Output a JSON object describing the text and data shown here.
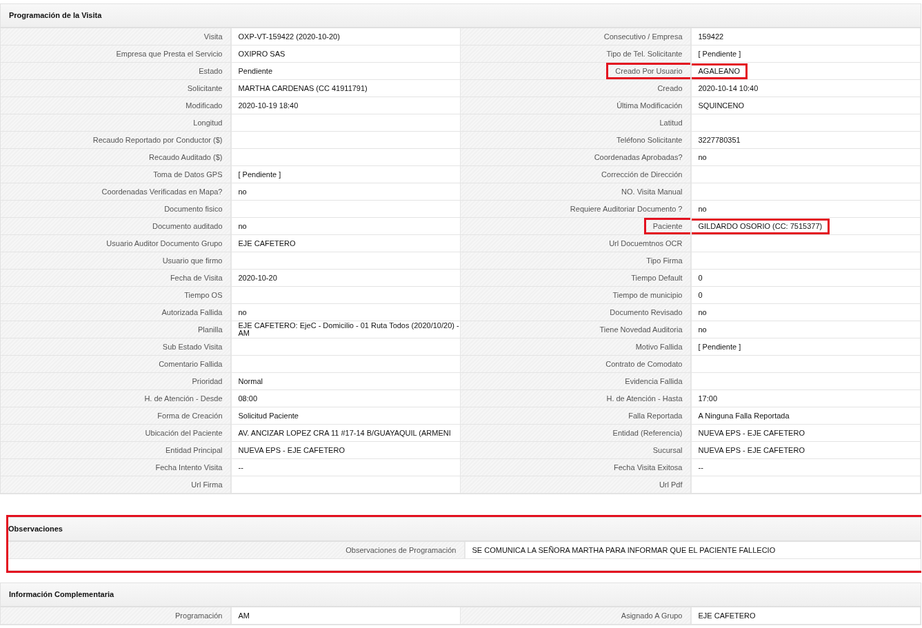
{
  "sections": [
    {
      "title": "Programación de la Visita",
      "highlighted": false,
      "rows": [
        [
          {
            "label": "Visita",
            "value": "OXP-VT-159422 (2020-10-20)",
            "highlighted": false
          },
          {
            "label": "Consecutivo / Empresa",
            "value": "159422",
            "highlighted": false
          }
        ],
        [
          {
            "label": "Empresa que Presta el Servicio",
            "value": "OXIPRO SAS",
            "highlighted": false
          },
          {
            "label": "Tipo de Tel. Solicitante",
            "value": "[ Pendiente ]",
            "highlighted": false
          }
        ],
        [
          {
            "label": "Estado",
            "value": "Pendiente",
            "highlighted": false
          },
          {
            "label": "Creado Por Usuario",
            "value": "AGALEANO",
            "highlighted": true
          }
        ],
        [
          {
            "label": "Solicitante",
            "value": "MARTHA CARDENAS (CC 41911791)",
            "highlighted": false
          },
          {
            "label": "Creado",
            "value": "2020-10-14 10:40",
            "highlighted": false
          }
        ],
        [
          {
            "label": "Modificado",
            "value": "2020-10-19 18:40",
            "highlighted": false
          },
          {
            "label": "Última Modificación",
            "value": "SQUINCENO",
            "highlighted": false
          }
        ],
        [
          {
            "label": "Longitud",
            "highlighted": false
          },
          {
            "label": "Latitud",
            "highlighted": false
          }
        ],
        [
          {
            "label": "Recaudo Reportado por Conductor ($)",
            "highlighted": false
          },
          {
            "label": "Teléfono Solicitante",
            "value": "3227780351",
            "highlighted": false
          }
        ],
        [
          {
            "label": "Recaudo Auditado ($)",
            "highlighted": false
          },
          {
            "label": "Coordenadas Aprobadas?",
            "value": "no",
            "highlighted": false
          }
        ],
        [
          {
            "label": "Toma de Datos GPS",
            "value": "[ Pendiente ]",
            "highlighted": false
          },
          {
            "label": "Corrección de Dirección",
            "highlighted": false
          }
        ],
        [
          {
            "label": "Coordenadas Verificadas en Mapa?",
            "value": "no",
            "highlighted": false
          },
          {
            "label": "NO. Visita Manual",
            "highlighted": false
          }
        ],
        [
          {
            "label": "Documento fisico",
            "highlighted": false
          },
          {
            "label": "Requiere Auditoriar Documento ?",
            "value": "no",
            "highlighted": false
          }
        ],
        [
          {
            "label": "Documento auditado",
            "value": "no",
            "highlighted": false
          },
          {
            "label": "Paciente",
            "value": "GILDARDO OSORIO (CC: 7515377)",
            "highlighted": true
          }
        ],
        [
          {
            "label": "Usuario Auditor Documento Grupo",
            "value": "EJE CAFETERO",
            "highlighted": false
          },
          {
            "label": "Url Docuemtnos OCR",
            "highlighted": false
          }
        ],
        [
          {
            "label": "Usuario que firmo",
            "highlighted": false
          },
          {
            "label": "Tipo Firma",
            "highlighted": false
          }
        ],
        [
          {
            "label": "Fecha de Visita",
            "value": "2020-10-20",
            "highlighted": false
          },
          {
            "label": "Tiempo Default",
            "value": "0",
            "highlighted": false
          }
        ],
        [
          {
            "label": "Tiempo OS",
            "highlighted": false
          },
          {
            "label": "Tiempo de municipio",
            "value": "0",
            "highlighted": false
          }
        ],
        [
          {
            "label": "Autorizada Fallida",
            "value": "no",
            "highlighted": false
          },
          {
            "label": "Documento Revisado",
            "value": "no",
            "highlighted": false
          }
        ],
        [
          {
            "label": "Planilla",
            "value": "EJE CAFETERO: EjeC - Domicilio - 01 Ruta Todos (2020/10/20) - AM",
            "highlighted": false
          },
          {
            "label": "Tiene Novedad Auditoria",
            "value": "no",
            "highlighted": false
          }
        ],
        [
          {
            "label": "Sub Estado Visita",
            "highlighted": false
          },
          {
            "label": "Motivo Fallida",
            "value": "[ Pendiente ]",
            "highlighted": false
          }
        ],
        [
          {
            "label": "Comentario Fallida",
            "highlighted": false
          },
          {
            "label": "Contrato de Comodato",
            "highlighted": false
          }
        ],
        [
          {
            "label": "Prioridad",
            "value": "Normal",
            "highlighted": false
          },
          {
            "label": "Evidencia Fallida",
            "highlighted": false
          }
        ],
        [
          {
            "label": "H. de Atención - Desde",
            "value": "08:00",
            "highlighted": false
          },
          {
            "label": "H. de Atención - Hasta",
            "value": "17:00",
            "highlighted": false
          }
        ],
        [
          {
            "label": "Forma de Creación",
            "value": "Solicitud Paciente",
            "highlighted": false
          },
          {
            "label": "Falla Reportada",
            "value": "A Ninguna Falla Reportada",
            "highlighted": false
          }
        ],
        [
          {
            "label": "Ubicación del Paciente",
            "value": "AV. ANCIZAR LOPEZ CRA 11 #17-14 B/GUAYAQUIL (ARMENI",
            "highlighted": false
          },
          {
            "label": "Entidad (Referencia)",
            "value": "NUEVA EPS - EJE CAFETERO",
            "highlighted": false
          }
        ],
        [
          {
            "label": "Entidad Principal",
            "value": "NUEVA EPS - EJE CAFETERO",
            "highlighted": false
          },
          {
            "label": "Sucursal",
            "value": "NUEVA EPS - EJE CAFETERO",
            "highlighted": false
          }
        ],
        [
          {
            "label": "Fecha Intento Visita",
            "value": "--",
            "highlighted": false
          },
          {
            "label": "Fecha Visita Exitosa",
            "value": "--",
            "highlighted": false
          }
        ],
        [
          {
            "label": "Url Firma",
            "highlighted": false
          },
          {
            "label": "Url Pdf",
            "highlighted": false
          }
        ]
      ]
    },
    {
      "title": "Observaciones",
      "highlighted": true,
      "rows": [
        [
          {
            "label": "Observaciones de Programación",
            "value": "SE COMUNICA LA SEÑORA MARTHA PARA INFORMAR QUE EL PACIENTE FALLECIO",
            "highlighted": false
          }
        ]
      ]
    },
    {
      "title": "Información Complementaria",
      "highlighted": false,
      "rows": [
        [
          {
            "label": "Programación",
            "value": "AM",
            "highlighted": false
          },
          {
            "label": "Asignado A Grupo",
            "value": "EJE CAFETERO",
            "highlighted": false
          }
        ]
      ]
    }
  ]
}
